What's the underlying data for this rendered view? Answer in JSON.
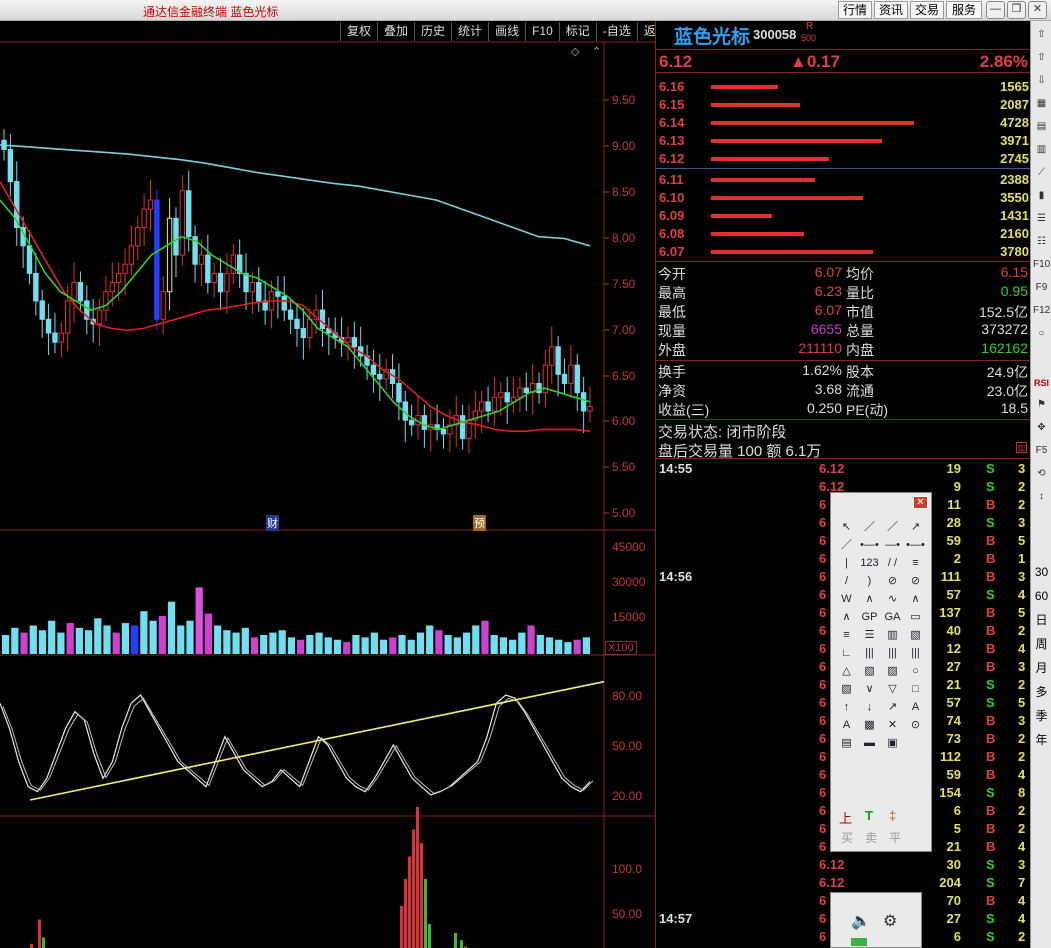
{
  "app": {
    "title": "通达信金融终端 蓝色光标"
  },
  "top_menu": [
    "行情",
    "资讯",
    "交易",
    "服务"
  ],
  "chart_toolbar": [
    "复权",
    "叠加",
    "历史",
    "统计",
    "画线",
    "F10",
    "标记",
    "-自选",
    "返回"
  ],
  "chart": {
    "price_axis": [
      "9.50",
      "9.00",
      "8.50",
      "8.00",
      "7.50",
      "7.00",
      "6.50",
      "6.00",
      "5.50",
      "5.00"
    ],
    "volume_axis": [
      "45000",
      "30000",
      "15000"
    ],
    "volume_unit": "X100",
    "kdj_axis": [
      "80.00",
      "50.00",
      "20.00"
    ],
    "bottom_axis": [
      "100.0",
      "50.00"
    ],
    "markers": [
      {
        "label": "财"
      },
      {
        "label": "预"
      }
    ]
  },
  "chart_data": {
    "type": "candlestick",
    "title": "",
    "ylim": [
      4.9,
      9.8
    ],
    "close": [
      8.95,
      8.6,
      8.1,
      7.9,
      7.6,
      7.3,
      7.1,
      6.95,
      6.85,
      6.95,
      7.3,
      7.5,
      7.3,
      7.1,
      7.05,
      7.2,
      7.4,
      7.5,
      7.6,
      7.7,
      7.9,
      8.1,
      8.3,
      8.4,
      7.1,
      7.4,
      8.2,
      7.8,
      8.5,
      8.0,
      7.7,
      7.8,
      7.5,
      7.6,
      7.4,
      7.6,
      7.8,
      7.6,
      7.4,
      7.5,
      7.3,
      7.2,
      7.4,
      7.35,
      7.2,
      7.1,
      7.0,
      6.9,
      7.1,
      7.2,
      7.0,
      6.95,
      6.9,
      6.85,
      6.9,
      6.8,
      6.7,
      6.6,
      6.5,
      6.45,
      6.55,
      6.4,
      6.2,
      6.0,
      5.95,
      6.05,
      5.9,
      5.95,
      5.9,
      5.85,
      5.95,
      6.05,
      5.8,
      6.0,
      6.1,
      6.2,
      6.1,
      6.25,
      6.3,
      6.2,
      6.25,
      6.35,
      6.3,
      6.4,
      6.3,
      6.6,
      6.8,
      6.5,
      6.4,
      6.6,
      6.3,
      6.1,
      6.15
    ],
    "ma_slow": [
      9.0,
      8.98,
      8.96,
      8.94,
      8.92,
      8.9,
      8.87,
      8.84,
      8.8,
      8.75,
      8.7,
      8.66,
      8.62,
      8.58,
      8.55,
      8.5,
      8.45,
      8.4,
      8.3,
      8.2,
      8.1,
      8.0,
      7.98,
      7.9
    ],
    "ma_mid": [
      8.6,
      8.3,
      8.0,
      7.7,
      7.4,
      7.2,
      7.05,
      7.0,
      6.98,
      7.0,
      7.05,
      7.1,
      7.15,
      7.2,
      7.22,
      7.25,
      7.28,
      7.3,
      7.3,
      7.25,
      7.1,
      6.95,
      6.8,
      6.7,
      6.55,
      6.45,
      6.3,
      6.15,
      6.05,
      5.98,
      5.95,
      5.9,
      5.88,
      5.88,
      5.9,
      5.9,
      5.9,
      5.88
    ],
    "ma_fast": [
      8.4,
      8.2,
      7.9,
      7.6,
      7.4,
      7.3,
      7.2,
      7.25,
      7.4,
      7.6,
      7.8,
      7.9,
      8.0,
      7.95,
      7.8,
      7.7,
      7.6,
      7.55,
      7.45,
      7.35,
      7.2,
      7.0,
      6.9,
      6.8,
      6.6,
      6.4,
      6.2,
      6.05,
      5.95,
      5.9,
      5.95,
      6.0,
      6.05,
      6.1,
      6.2,
      6.3,
      6.35,
      6.3,
      6.25,
      6.2
    ],
    "volume": [
      8000,
      11000,
      9000,
      12000,
      10000,
      14000,
      9000,
      13000,
      11000,
      10000,
      15000,
      12000,
      9000,
      13000,
      12000,
      18000,
      14000,
      16000,
      22000,
      12000,
      14000,
      28000,
      17000,
      12000,
      10000,
      9000,
      11000,
      7000,
      8000,
      9000,
      10000,
      7000,
      6000,
      8000,
      9000,
      7000,
      6000,
      5000,
      8000,
      7000,
      9000,
      6000,
      7000,
      8000,
      6000,
      9000,
      12000,
      10000,
      8000,
      7000,
      9000,
      12000,
      14000,
      8000,
      7000,
      6000,
      9000,
      12000,
      8000,
      7000,
      6000,
      5000,
      6000,
      7000
    ],
    "k_line": [
      75,
      60,
      40,
      25,
      22,
      30,
      45,
      60,
      70,
      65,
      45,
      30,
      40,
      60,
      75,
      80,
      70,
      60,
      50,
      40,
      35,
      30,
      25,
      40,
      55,
      45,
      35,
      30,
      25,
      28,
      35,
      30,
      25,
      40,
      55,
      50,
      40,
      30,
      25,
      22,
      30,
      40,
      50,
      40,
      30,
      25,
      20,
      22,
      25,
      30,
      35,
      40,
      55,
      75,
      80,
      78,
      70,
      60,
      50,
      40,
      30,
      25,
      22,
      28
    ],
    "trendline": [
      [
        0,
        17
      ],
      [
        60,
        88
      ]
    ]
  },
  "quote": {
    "name": "蓝色光标",
    "code": "300058",
    "flag_r": "R",
    "flag_num": "500",
    "price": "6.12",
    "change": "▲0.17",
    "pct": "2.86%",
    "asks": [
      {
        "price": "6.16",
        "vol": "1565",
        "frac": 0.33
      },
      {
        "price": "6.15",
        "vol": "2087",
        "frac": 0.44
      },
      {
        "price": "6.14",
        "vol": "4728",
        "frac": 1.0
      },
      {
        "price": "6.13",
        "vol": "3971",
        "frac": 0.84
      },
      {
        "price": "6.12",
        "vol": "2745",
        "frac": 0.58
      }
    ],
    "bids": [
      {
        "price": "6.11",
        "vol": "2388",
        "frac": 0.51
      },
      {
        "price": "6.10",
        "vol": "3550",
        "frac": 0.75
      },
      {
        "price": "6.09",
        "vol": "1431",
        "frac": 0.3
      },
      {
        "price": "6.08",
        "vol": "2160",
        "frac": 0.46
      },
      {
        "price": "6.07",
        "vol": "3780",
        "frac": 0.8
      }
    ],
    "stats": [
      {
        "l": "今开",
        "v": "6.07",
        "vc": "#e04040",
        "l2": "均价",
        "v2": "6.15",
        "vc2": "#e04040"
      },
      {
        "l": "最高",
        "v": "6.23",
        "vc": "#e04040",
        "l2": "量比",
        "v2": "0.95",
        "vc2": "#30d030"
      },
      {
        "l": "最低",
        "v": "6.07",
        "vc": "#e04040",
        "l2": "市值",
        "v2": "152.5亿",
        "vc2": "#dddddd"
      },
      {
        "l": "现量",
        "v": "6655",
        "vc": "#c040c0",
        "l2": "总量",
        "v2": "373272",
        "vc2": "#dddddd"
      },
      {
        "l": "外盘",
        "v": "211110",
        "vc": "#e04040",
        "l2": "内盘",
        "v2": "162162",
        "vc2": "#30d030"
      }
    ],
    "stats2": [
      {
        "l": "换手",
        "v": "1.62%",
        "l2": "股本",
        "v2": "24.9亿"
      },
      {
        "l": "净资",
        "v": "3.68",
        "l2": "流通",
        "v2": "23.0亿"
      },
      {
        "l": "收益(三)",
        "v": "0.250",
        "l2": "PE(动)",
        "v2": "18.5"
      }
    ],
    "status": "交易状态: 闭市阶段",
    "after_hours": "盘后交易量 100 额 6.1万",
    "ticks": [
      {
        "t": "14:55",
        "p": "6.12",
        "v": "19",
        "bs": "S",
        "n": "3"
      },
      {
        "t": "",
        "p": "6.12",
        "v": "9",
        "bs": "S",
        "n": "2"
      },
      {
        "t": "",
        "p": "6",
        "v": "11",
        "bs": "B",
        "n": "2"
      },
      {
        "t": "",
        "p": "6",
        "v": "28",
        "bs": "S",
        "n": "3"
      },
      {
        "t": "",
        "p": "6",
        "v": "59",
        "bs": "B",
        "n": "5"
      },
      {
        "t": "",
        "p": "6",
        "v": "2",
        "bs": "B",
        "n": "1"
      },
      {
        "t": "14:56",
        "p": "6",
        "v": "111",
        "bs": "B",
        "n": "3"
      },
      {
        "t": "",
        "p": "6",
        "v": "57",
        "bs": "S",
        "n": "4"
      },
      {
        "t": "",
        "p": "6",
        "v": "137",
        "bs": "B",
        "n": "5"
      },
      {
        "t": "",
        "p": "6",
        "v": "40",
        "bs": "B",
        "n": "2"
      },
      {
        "t": "",
        "p": "6",
        "v": "12",
        "bs": "B",
        "n": "4"
      },
      {
        "t": "",
        "p": "6",
        "v": "27",
        "bs": "B",
        "n": "3"
      },
      {
        "t": "",
        "p": "6",
        "v": "21",
        "bs": "S",
        "n": "2"
      },
      {
        "t": "",
        "p": "6",
        "v": "57",
        "bs": "S",
        "n": "5"
      },
      {
        "t": "",
        "p": "6",
        "v": "74",
        "bs": "B",
        "n": "3"
      },
      {
        "t": "",
        "p": "6",
        "v": "73",
        "bs": "B",
        "n": "2"
      },
      {
        "t": "",
        "p": "6",
        "v": "112",
        "bs": "B",
        "n": "2"
      },
      {
        "t": "",
        "p": "6",
        "v": "59",
        "bs": "B",
        "n": "4"
      },
      {
        "t": "",
        "p": "6",
        "v": "154",
        "bs": "S",
        "n": "8"
      },
      {
        "t": "",
        "p": "6",
        "v": "6",
        "bs": "B",
        "n": "2"
      },
      {
        "t": "",
        "p": "6",
        "v": "5",
        "bs": "B",
        "n": "2"
      },
      {
        "t": "",
        "p": "6",
        "v": "21",
        "bs": "B",
        "n": "4"
      },
      {
        "t": "",
        "p": "6.12",
        "v": "30",
        "bs": "S",
        "n": "3"
      },
      {
        "t": "",
        "p": "6.12",
        "v": "204",
        "bs": "S",
        "n": "7"
      },
      {
        "t": "",
        "p": "6",
        "v": "70",
        "bs": "B",
        "n": "4"
      },
      {
        "t": "14:57",
        "p": "6",
        "v": "27",
        "bs": "S",
        "n": "4"
      },
      {
        "t": "",
        "p": "6",
        "v": "6",
        "bs": "S",
        "n": "2"
      }
    ]
  },
  "right_toolbar": {
    "icons": [
      "up-arrow",
      "up-arrow-2",
      "down-arrow",
      "grid",
      "layout",
      "bar-chart",
      "line-chart",
      "candle",
      "list",
      "list2",
      "f10",
      "f9",
      "f12",
      "circle"
    ],
    "rsi_label": "RSI",
    "text_labels": [
      "30",
      "60",
      "日",
      "周",
      "月",
      "多",
      "季",
      "年"
    ]
  },
  "draw_palette": {
    "tools": [
      "↖",
      "／",
      "／",
      "↗",
      "／",
      "•—•",
      "—•",
      "•—•",
      "|",
      "123",
      "/ /",
      "≡",
      "/",
      ")",
      "⊘",
      "⊘",
      "W",
      "∧",
      "∿",
      "∧",
      "∧",
      "GP",
      "GA",
      "▭",
      "≡",
      "☰",
      "▥",
      "▧",
      "∟",
      "|||",
      "|||",
      "|||",
      "△",
      "▧",
      "▨",
      "○",
      "▧",
      "∨",
      "▽",
      "□",
      "↑",
      "↓",
      "↗",
      "A",
      "A",
      "▩",
      "✕",
      "⊙",
      "▤",
      "▬",
      "▣",
      ""
    ],
    "trade_buy": "上",
    "trade_t": "T",
    "trade_other": "‡",
    "buy": "买",
    "sell": "卖",
    "flat": "平"
  }
}
